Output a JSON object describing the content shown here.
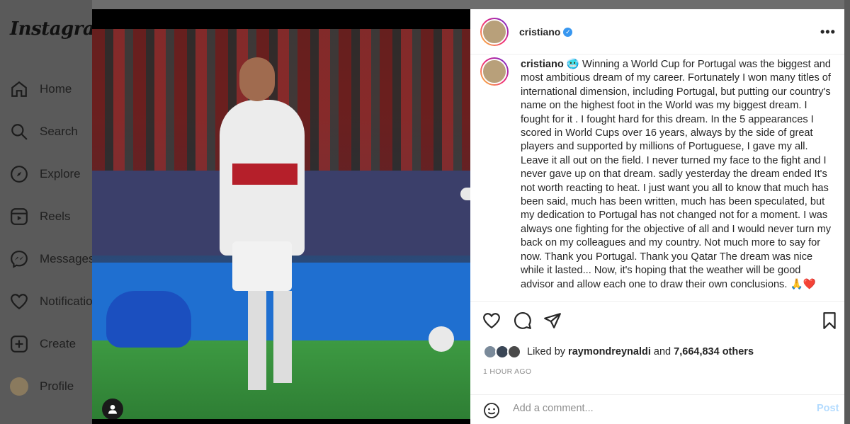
{
  "sidebar": {
    "logo": "Instagram",
    "items": [
      {
        "label": "Home",
        "icon": "home-icon"
      },
      {
        "label": "Search",
        "icon": "search-icon"
      },
      {
        "label": "Explore",
        "icon": "compass-icon"
      },
      {
        "label": "Reels",
        "icon": "reels-icon"
      },
      {
        "label": "Messages",
        "icon": "messenger-icon"
      },
      {
        "label": "Notificatio",
        "icon": "heart-icon"
      },
      {
        "label": "Create",
        "icon": "plus-square-icon"
      },
      {
        "label": "Profile",
        "icon": "avatar"
      }
    ]
  },
  "post": {
    "author": "cristiano",
    "verified": true,
    "caption_user": "cristiano",
    "caption": "🥶 Winning a World Cup for Portugal was the biggest and most ambitious dream of my career. Fortunately I won many titles of international dimension, including Portugal, but putting our country's name on the highest foot in the World was my biggest dream. I fought for it . I fought hard for this dream. In the 5 appearances I scored in World Cups over 16 years, always by the side of great players and supported by millions of Portuguese, I gave my all. Leave it all out on the field. I never turned my face to the fight and I never gave up on that dream. sadly yesterday the dream ended It's not worth reacting to heat. I just want you all to know that much has been said, much has been written, much has been speculated, but my dedication to Portugal has not changed not for a moment. I was always one fighting for the objective of all and I would never turn my back on my colleagues and my country. Not much more to say for now. Thank you Portugal. Thank you Qatar The dream was nice while it lasted... Now, it's hoping that the weather will be good advisor and allow each one to draw their own conclusions. 🙏❤️",
    "likes_prefix": "Liked by",
    "liked_by_user": "raymondreynaldi",
    "likes_and": "and",
    "likes_count": "7,664,834 others",
    "timestamp": "1 HOUR AGO",
    "comment_placeholder": "Add a comment...",
    "post_button": "Post"
  },
  "colors": {
    "verified": "#3897f0",
    "post_button_disabled": "#b3dbff",
    "overlay": "#6b6b6b"
  }
}
